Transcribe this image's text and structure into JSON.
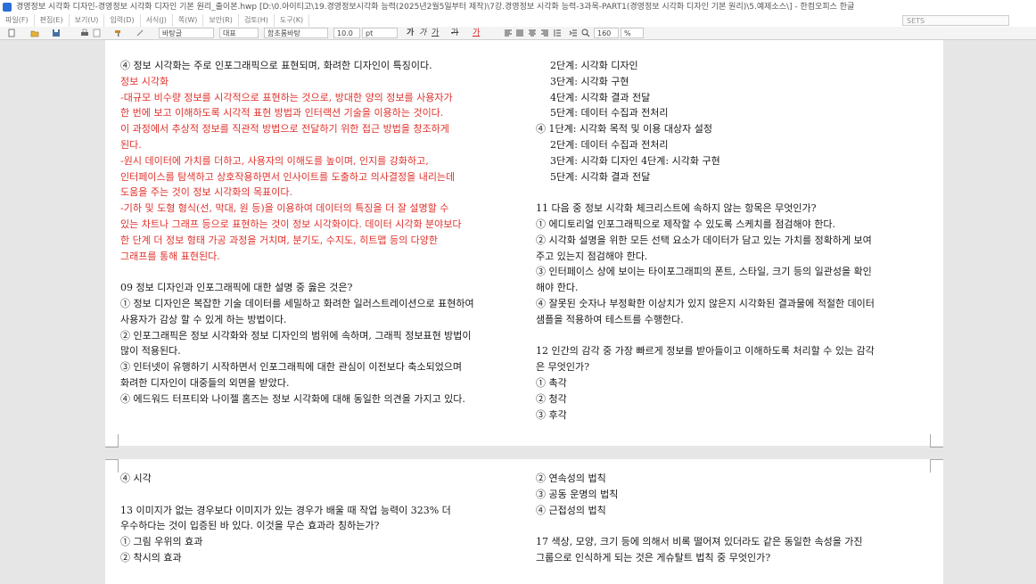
{
  "window": {
    "title": "경영정보 시각화 디자인-경영정보 시각화 디자인 기본 원리_출이본.hwp [D:\\0.아이티고\\19.경영정보시각화 능력(2025년2월5일부터 제작)\\7강.경영정보 시각화 능력-3과목-PART1(경영정보 시각화 디자인 기본 원리)\\5.예제소스\\] - 한컴오피스 한글"
  },
  "menu": {
    "items": [
      "파일(F)",
      "편집(E)",
      "보기(U)",
      "입력(D)",
      "서식(J)",
      "쪽(W)",
      "보안(R)",
      "검토(H)",
      "도구(K)"
    ],
    "search_placeholder": "SETS"
  },
  "toolbar": {
    "style": "바탕글",
    "lang": "대표",
    "font": "함초롬바탕",
    "size": "10.0",
    "unit": "pt",
    "bold": "가",
    "italic": "가",
    "underline": "가",
    "strike": "가",
    "color": "가",
    "zoom": "160",
    "zoom_unit": "%"
  },
  "page1": {
    "left": [
      {
        "text": "④ 정보 시각화는 주로 인포그래픽으로 표현되며, 화려한 디자인이 특징이다.",
        "style": "normal"
      },
      {
        "text": "정보 시각화",
        "style": "red"
      },
      {
        "text": "-대규모 비수량 정보를 시각적으로 표현하는 것으로, 방대한 양의 정보를 사용자가",
        "style": "red"
      },
      {
        "text": "한 번에 보고 이해하도록 시각적 표현 방법과 인터랙션 기술을 이용하는 것이다.",
        "style": "red"
      },
      {
        "text": "이 과정에서 추상적 정보를 직관적 방법으로 전달하기 위한 접근 방법을 창조하게",
        "style": "red"
      },
      {
        "text": "된다.",
        "style": "red"
      },
      {
        "text": "-원시 데이터에 가치를 더하고, 사용자의 이해도를 높이며, 인지를 강화하고,",
        "style": "red"
      },
      {
        "text": "인터페이스를 탐색하고 상호작용하면서 인사이트를 도출하고 의사결정을 내리는데",
        "style": "red"
      },
      {
        "text": "도움을 주는 것이 정보 시각화의 목표이다.",
        "style": "red"
      },
      {
        "text": "-기하 및 도형 형식(선, 막대, 원 등)을 이용하여 데이터의 특징을 더 잘 설명할 수",
        "style": "red"
      },
      {
        "text": "있는 차트나 그래프 등으로 표현하는 것이 정보 시각화이다. 데이터 시각화 분야보다",
        "style": "red"
      },
      {
        "text": "한 단계 더 정보 형태 가공 과정을 거치며, 분기도, 수지도, 히트맵 등의 다양한",
        "style": "red"
      },
      {
        "text": "그래프를 통해 표현된다.",
        "style": "red"
      },
      {
        "text": "",
        "style": "gap"
      },
      {
        "text": "09 정보 디자인과 인포그래픽에 대한 설명 중 옳은 것은?",
        "style": "normal"
      },
      {
        "text": "① 정보 디자인은 복잡한 기술 데이터를 세밀하고 화려한 일러스트레이션으로 표현하여",
        "style": "normal"
      },
      {
        "text": "사용자가 감상 할 수 있게 하는 방법이다.",
        "style": "normal"
      },
      {
        "text": "② 인포그래픽은 정보 시각화와 정보 디자인의 범위에 속하며, 그래픽 정보표현 방법이",
        "style": "normal"
      },
      {
        "text": "많이 적용된다.",
        "style": "normal"
      },
      {
        "text": "③ 인터넷이 유행하기 시작하면서 인포그래픽에 대한 관심이 이전보다 축소되었으며",
        "style": "normal"
      },
      {
        "text": "화려한 디자인이 대중들의 외면을 받았다.",
        "style": "normal"
      },
      {
        "text": "④ 에드워드 터프티와 나이젤 홈즈는 정보 시각화에 대해 동일한 의견을 가지고 있다.",
        "style": "normal"
      }
    ],
    "right": [
      {
        "text": "2단계: 시각화 디자인",
        "style": "indent"
      },
      {
        "text": "3단계: 시각화 구현",
        "style": "indent"
      },
      {
        "text": "4단계: 시각화 결과 전달",
        "style": "indent"
      },
      {
        "text": "5단계: 데이터 수집과 전처리",
        "style": "indent"
      },
      {
        "text": "④ 1단계: 시각화 목적 및 이용 대상자 설정",
        "style": "normal"
      },
      {
        "text": "2단계: 데이터 수집과 전처리",
        "style": "indent"
      },
      {
        "text": "3단계: 시각화 디자인 4단계: 시각화 구현",
        "style": "indent"
      },
      {
        "text": "5단계: 시각화 결과 전달",
        "style": "indent"
      },
      {
        "text": "",
        "style": "gap"
      },
      {
        "text": "11 다음 중 정보 시각화 체크리스트에 속하지 않는 항목은 무엇인가?",
        "style": "normal"
      },
      {
        "text": "① 에디토리얼 인포그래픽으로 제작할 수 있도록 스케치를 점검해야 한다.",
        "style": "normal"
      },
      {
        "text": "② 시각화 설명을 위한 모든 선택 요소가 데이터가 담고 있는 가치를 정확하게 보여",
        "style": "normal"
      },
      {
        "text": "주고 있는지 점검해야 한다.",
        "style": "normal"
      },
      {
        "text": "③ 인터페이스 상에 보이는 타이포그래피의 폰트, 스타일, 크기 등의 일관성을 확인",
        "style": "normal"
      },
      {
        "text": "해야 한다.",
        "style": "normal"
      },
      {
        "text": "④ 잘못된 숫자나 부정확한 이상치가 있지 않은지 시각화된 결과물에 적절한 데이터",
        "style": "normal"
      },
      {
        "text": "샘플을 적용하여 테스트를 수행한다.",
        "style": "normal"
      },
      {
        "text": "",
        "style": "gap"
      },
      {
        "text": "12 인간의 감각 중 가장 빠르게 정보를 받아들이고 이해하도록 처리할 수 있는 감각",
        "style": "normal"
      },
      {
        "text": "은 무엇인가?",
        "style": "normal"
      },
      {
        "text": "① 촉각",
        "style": "normal"
      },
      {
        "text": "② 청각",
        "style": "normal"
      },
      {
        "text": "③ 후각",
        "style": "normal"
      }
    ]
  },
  "page2": {
    "left": [
      {
        "text": "④ 시각",
        "style": "normal"
      },
      {
        "text": "",
        "style": "gap"
      },
      {
        "text": "13 이미지가 없는 경우보다 이미지가 있는 경우가 배울 때 작업 능력이 323% 더",
        "style": "normal"
      },
      {
        "text": "우수하다는 것이 입증된 바 있다. 이것을 무슨 효과라 칭하는가?",
        "style": "normal"
      },
      {
        "text": "① 그림 우위의 효과",
        "style": "normal"
      },
      {
        "text": "② 착시의 효과",
        "style": "normal"
      }
    ],
    "right": [
      {
        "text": "② 연속성의 법칙",
        "style": "normal"
      },
      {
        "text": "③ 공동 운명의 법칙",
        "style": "normal"
      },
      {
        "text": "④ 근접성의 법칙",
        "style": "normal"
      },
      {
        "text": "",
        "style": "gap"
      },
      {
        "text": "17 색상, 모양, 크기 등에 의해서 비록 떨어져 있더라도 같은 동일한 속성을 가진",
        "style": "normal"
      },
      {
        "text": "그룹으로 인식하게 되는 것은 게슈탈트 법칙 중 무엇인가?",
        "style": "normal"
      }
    ]
  }
}
